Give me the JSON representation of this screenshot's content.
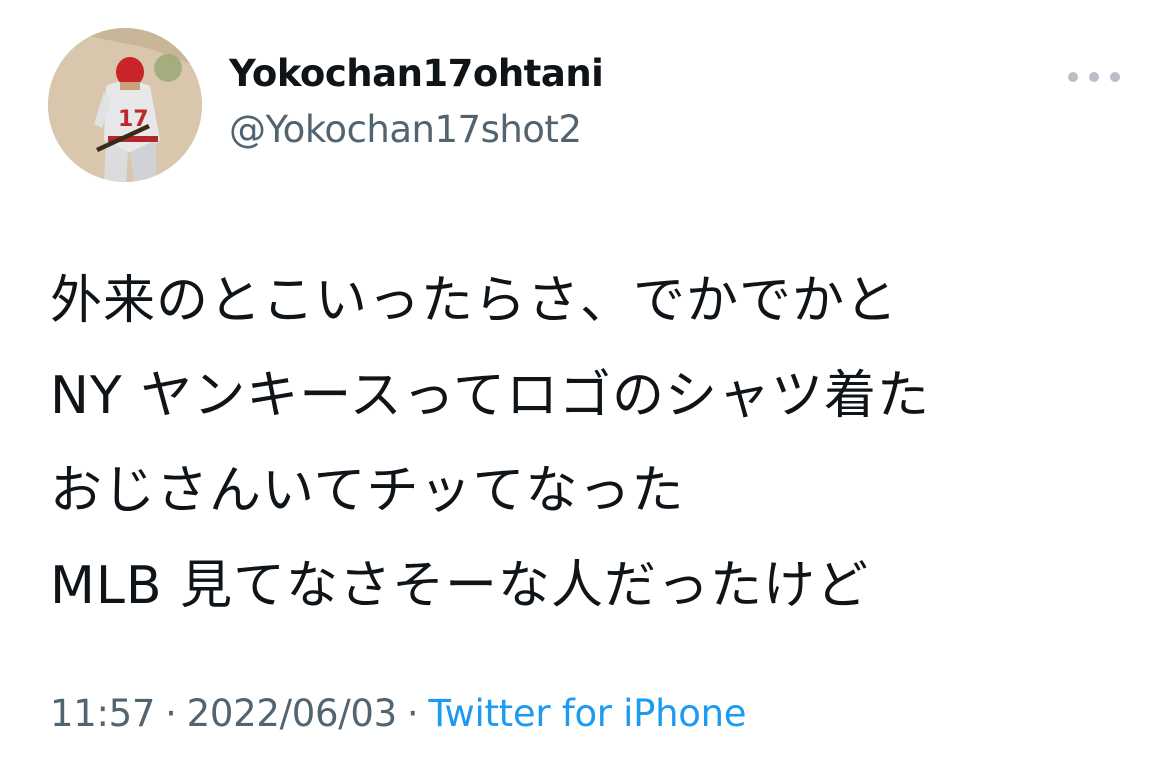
{
  "author": {
    "display_name": "Yokochan17ohtani",
    "handle": "@Yokochan17shot2",
    "avatar_icon": "baseball-player-avatar"
  },
  "more_icon": "more-horizontal-icon",
  "tweet": {
    "lines": [
      "外来のとこいったらさ、でかでかと",
      "NY ヤンキースってロゴのシャツ着た",
      "おじさんいてチッてなった",
      "MLB 見てなさそーな人だったけど"
    ]
  },
  "meta": {
    "time": "11:57",
    "separator": "·",
    "date": "2022/06/03",
    "source": "Twitter for iPhone"
  },
  "colors": {
    "text": "#0f1419",
    "secondary": "#536471",
    "link": "#1d9bf0",
    "background": "#ffffff"
  }
}
